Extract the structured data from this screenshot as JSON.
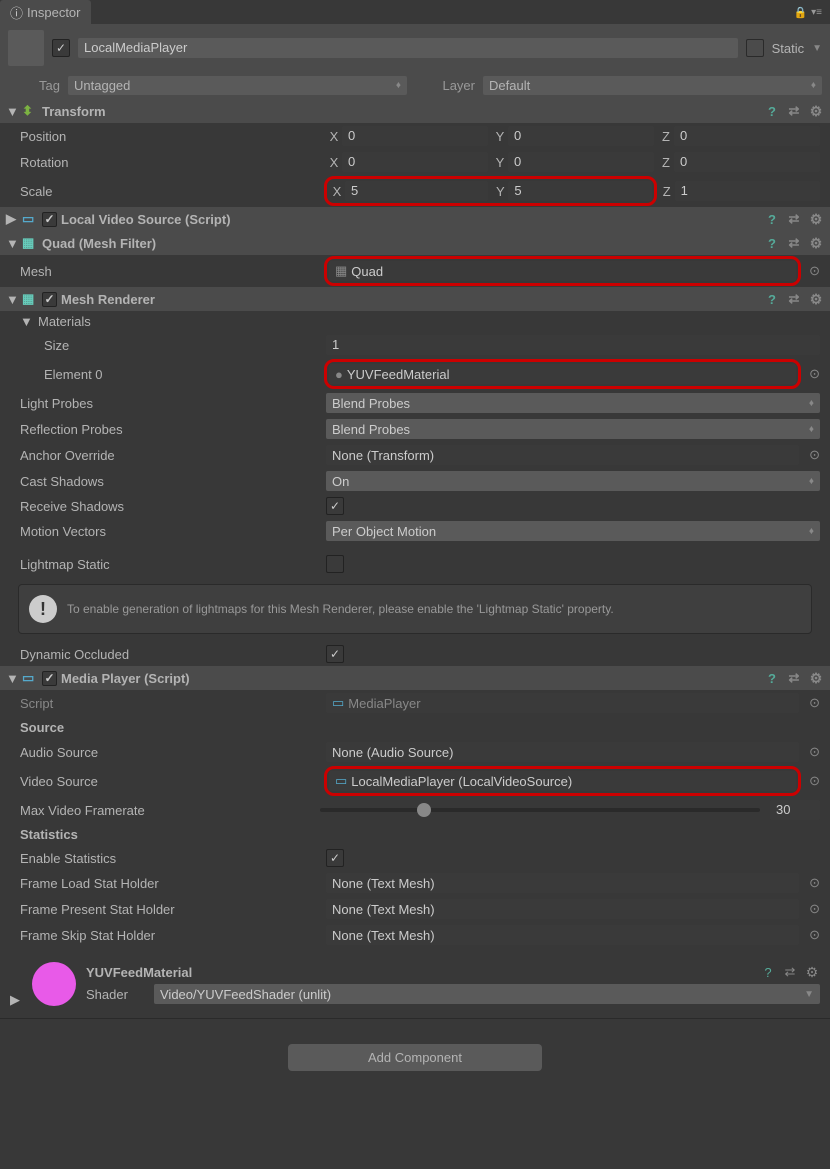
{
  "inspector": {
    "tab_label": "Inspector"
  },
  "gameobject": {
    "name": "LocalMediaPlayer",
    "active": true,
    "static_label": "Static ",
    "tag_label": "Tag",
    "tag_value": "Untagged",
    "layer_label": "Layer",
    "layer_value": "Default"
  },
  "transform": {
    "title": "Transform",
    "position_label": "Position",
    "rotation_label": "Rotation",
    "scale_label": "Scale",
    "position": {
      "x": "0",
      "y": "0",
      "z": "0"
    },
    "rotation": {
      "x": "0",
      "y": "0",
      "z": "0"
    },
    "scale": {
      "x": "5",
      "y": "5",
      "z": "1"
    }
  },
  "localvideo": {
    "title": "Local Video Source (Script)"
  },
  "meshfilter": {
    "title": "Quad (Mesh Filter)",
    "mesh_label": "Mesh",
    "mesh_value": "Quad"
  },
  "meshrenderer": {
    "title": "Mesh Renderer",
    "materials_label": "Materials",
    "size_label": "Size",
    "size_value": "1",
    "element0_label": "Element 0",
    "element0_value": "YUVFeedMaterial",
    "light_probes_label": "Light Probes",
    "light_probes_value": "Blend Probes",
    "reflection_probes_label": "Reflection Probes",
    "reflection_probes_value": "Blend Probes",
    "anchor_override_label": "Anchor Override",
    "anchor_override_value": "None (Transform)",
    "cast_shadows_label": "Cast Shadows",
    "cast_shadows_value": "On",
    "receive_shadows_label": "Receive Shadows",
    "motion_vectors_label": "Motion Vectors",
    "motion_vectors_value": "Per Object Motion",
    "lightmap_static_label": "Lightmap Static",
    "info_text": "To enable generation of lightmaps for this Mesh Renderer, please enable the 'Lightmap Static' property.",
    "dynamic_occluded_label": "Dynamic Occluded"
  },
  "mediaplayer": {
    "title": "Media Player (Script)",
    "script_label": "Script",
    "script_value": "MediaPlayer",
    "source_header": "Source",
    "audio_source_label": "Audio Source",
    "audio_source_value": "None (Audio Source)",
    "video_source_label": "Video Source",
    "video_source_value": "LocalMediaPlayer (LocalVideoSource)",
    "max_framerate_label": "Max Video Framerate",
    "max_framerate_value": "30",
    "statistics_header": "Statistics",
    "enable_statistics_label": "Enable Statistics",
    "frame_load_label": "Frame Load Stat Holder",
    "frame_load_value": "None (Text Mesh)",
    "frame_present_label": "Frame Present Stat Holder",
    "frame_present_value": "None (Text Mesh)",
    "frame_skip_label": "Frame Skip Stat Holder",
    "frame_skip_value": "None (Text Mesh)"
  },
  "material": {
    "name": "YUVFeedMaterial",
    "shader_label": "Shader",
    "shader_value": "Video/YUVFeedShader (unlit)"
  },
  "add_component_label": "Add Component"
}
